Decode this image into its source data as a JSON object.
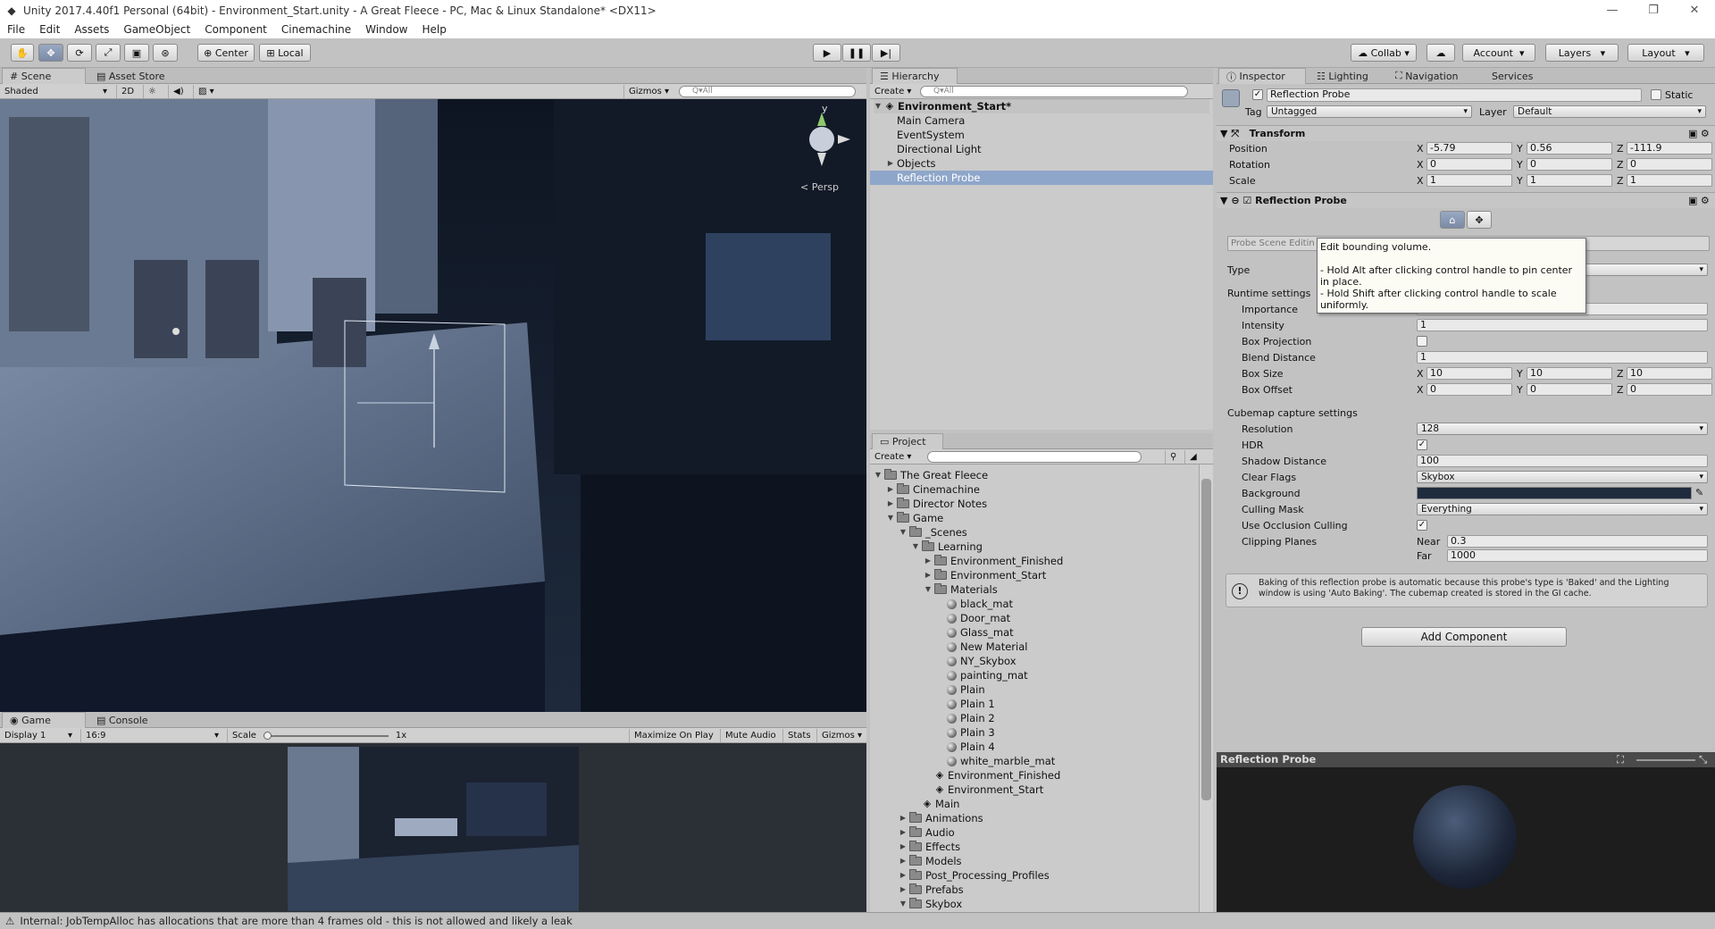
{
  "window": {
    "title": "Unity 2017.4.40f1 Personal (64bit) - Environment_Start.unity - A Great Fleece - PC, Mac & Linux Standalone* <DX11>"
  },
  "menu": [
    "File",
    "Edit",
    "Assets",
    "GameObject",
    "Component",
    "Cinemachine",
    "Window",
    "Help"
  ],
  "toolbar": {
    "pivot": "Center",
    "space": "Local",
    "collab": "Collab",
    "account": "Account",
    "layers": "Layers",
    "layout": "Layout"
  },
  "scene": {
    "tab_scene": "Scene",
    "tab_asset_store": "Asset Store",
    "shading": "Shaded",
    "mode_2d": "2D",
    "gizmos": "Gizmos",
    "search_placeholder": "Q▾All",
    "persp_label": "< Persp",
    "axis_y": "y"
  },
  "game": {
    "tab_game": "Game",
    "tab_console": "Console",
    "display": "Display 1",
    "aspect": "16:9",
    "scale_label": "Scale",
    "scale_value": "1x",
    "maximize": "Maximize On Play",
    "mute": "Mute Audio",
    "stats": "Stats",
    "gizmos": "Gizmos"
  },
  "hierarchy": {
    "tab": "Hierarchy",
    "create": "Create",
    "search_placeholder": "Q▾All",
    "scene_name": "Environment_Start*",
    "items": [
      "Main Camera",
      "EventSystem",
      "Directional Light",
      "Objects",
      "Reflection Probe"
    ]
  },
  "project": {
    "tab": "Project",
    "create": "Create",
    "root": "The Great Fleece",
    "rows": [
      {
        "label": "Cinemachine",
        "indent": 1,
        "type": "folder",
        "arrow": "▶"
      },
      {
        "label": "Director Notes",
        "indent": 1,
        "type": "folder",
        "arrow": "▶"
      },
      {
        "label": "Game",
        "indent": 1,
        "type": "folder",
        "arrow": "▼"
      },
      {
        "label": "_Scenes",
        "indent": 2,
        "type": "folder",
        "arrow": "▼"
      },
      {
        "label": "Learning",
        "indent": 3,
        "type": "folder",
        "arrow": "▼"
      },
      {
        "label": "Environment_Finished",
        "indent": 4,
        "type": "folder",
        "arrow": "▶"
      },
      {
        "label": "Environment_Start",
        "indent": 4,
        "type": "folder",
        "arrow": "▶"
      },
      {
        "label": "Materials",
        "indent": 4,
        "type": "folder",
        "arrow": "▼"
      },
      {
        "label": "black_mat",
        "indent": 5,
        "type": "mat",
        "arrow": ""
      },
      {
        "label": "Door_mat",
        "indent": 5,
        "type": "mat",
        "arrow": ""
      },
      {
        "label": "Glass_mat",
        "indent": 5,
        "type": "mat",
        "arrow": ""
      },
      {
        "label": "New Material",
        "indent": 5,
        "type": "mat",
        "arrow": ""
      },
      {
        "label": "NY_Skybox",
        "indent": 5,
        "type": "mat",
        "arrow": ""
      },
      {
        "label": "painting_mat",
        "indent": 5,
        "type": "mat",
        "arrow": ""
      },
      {
        "label": "Plain",
        "indent": 5,
        "type": "mat",
        "arrow": ""
      },
      {
        "label": "Plain 1",
        "indent": 5,
        "type": "mat",
        "arrow": ""
      },
      {
        "label": "Plain 2",
        "indent": 5,
        "type": "mat",
        "arrow": ""
      },
      {
        "label": "Plain 3",
        "indent": 5,
        "type": "mat",
        "arrow": ""
      },
      {
        "label": "Plain 4",
        "indent": 5,
        "type": "mat",
        "arrow": ""
      },
      {
        "label": "white_marble_mat",
        "indent": 5,
        "type": "mat",
        "arrow": ""
      },
      {
        "label": "Environment_Finished",
        "indent": 4,
        "type": "scene",
        "arrow": ""
      },
      {
        "label": "Environment_Start",
        "indent": 4,
        "type": "scene",
        "arrow": ""
      },
      {
        "label": "Main",
        "indent": 3,
        "type": "scene",
        "arrow": ""
      },
      {
        "label": "Animations",
        "indent": 2,
        "type": "folder",
        "arrow": "▶"
      },
      {
        "label": "Audio",
        "indent": 2,
        "type": "folder",
        "arrow": "▶"
      },
      {
        "label": "Effects",
        "indent": 2,
        "type": "folder",
        "arrow": "▶"
      },
      {
        "label": "Models",
        "indent": 2,
        "type": "folder",
        "arrow": "▶"
      },
      {
        "label": "Post_Processing_Profiles",
        "indent": 2,
        "type": "folder",
        "arrow": "▶"
      },
      {
        "label": "Prefabs",
        "indent": 2,
        "type": "folder",
        "arrow": "▶"
      },
      {
        "label": "Skybox",
        "indent": 2,
        "type": "folder",
        "arrow": "▼"
      }
    ]
  },
  "inspector": {
    "tabs": [
      "Inspector",
      "Lighting",
      "Navigation",
      "Services"
    ],
    "object_name": "Reflection Probe",
    "static_label": "Static",
    "tag_label": "Tag",
    "tag_value": "Untagged",
    "layer_label": "Layer",
    "layer_value": "Default",
    "transform": {
      "title": "Transform",
      "position_label": "Position",
      "position": [
        "-5.79",
        "0.56",
        "-111.9"
      ],
      "rotation_label": "Rotation",
      "rotation": [
        "0",
        "0",
        "0"
      ],
      "scale_label": "Scale",
      "scale": [
        "1",
        "1",
        "1"
      ]
    },
    "probe": {
      "title": "Reflection Probe",
      "scene_editing": "Probe Scene Editin",
      "type_label": "Type",
      "runtime_label": "Runtime settings",
      "importance_label": "Importance",
      "intensity_label": "Intensity",
      "intensity": "1",
      "box_projection_label": "Box Projection",
      "blend_label": "Blend Distance",
      "blend": "1",
      "box_size_label": "Box Size",
      "box_size": [
        "10",
        "10",
        "10"
      ],
      "box_offset_label": "Box Offset",
      "box_offset": [
        "0",
        "0",
        "0"
      ],
      "cubemap_label": "Cubemap capture settings",
      "resolution_label": "Resolution",
      "resolution": "128",
      "hdr_label": "HDR",
      "shadow_label": "Shadow Distance",
      "shadow": "100",
      "clear_label": "Clear Flags",
      "clear": "Skybox",
      "background_label": "Background",
      "culling_label": "Culling Mask",
      "culling": "Everything",
      "occlusion_label": "Use Occlusion Culling",
      "clipping_label": "Clipping Planes",
      "near_label": "Near",
      "near": "0.3",
      "far_label": "Far",
      "far": "1000",
      "info": "Baking of this reflection probe is automatic because this probe's type is 'Baked' and the Lighting window is using 'Auto Baking'. The cubemap created is stored in the GI cache."
    },
    "add_component": "Add Component",
    "preview_title": "Reflection Probe",
    "axis_x": "X",
    "axis_y": "Y",
    "axis_z": "Z"
  },
  "tooltip": "Edit bounding volume.\n\n - Hold Alt after clicking control handle to pin center in place.\n - Hold Shift after clicking control handle to scale uniformly.",
  "status": "Internal: JobTempAlloc has allocations that are more than 4 frames old - this is not allowed and likely a leak",
  "colors": {
    "selection": "#8ea6c9",
    "scene_bg": "#1a2232",
    "panel": "#c2c2c2",
    "background_swatch": "#1f2c3e"
  }
}
